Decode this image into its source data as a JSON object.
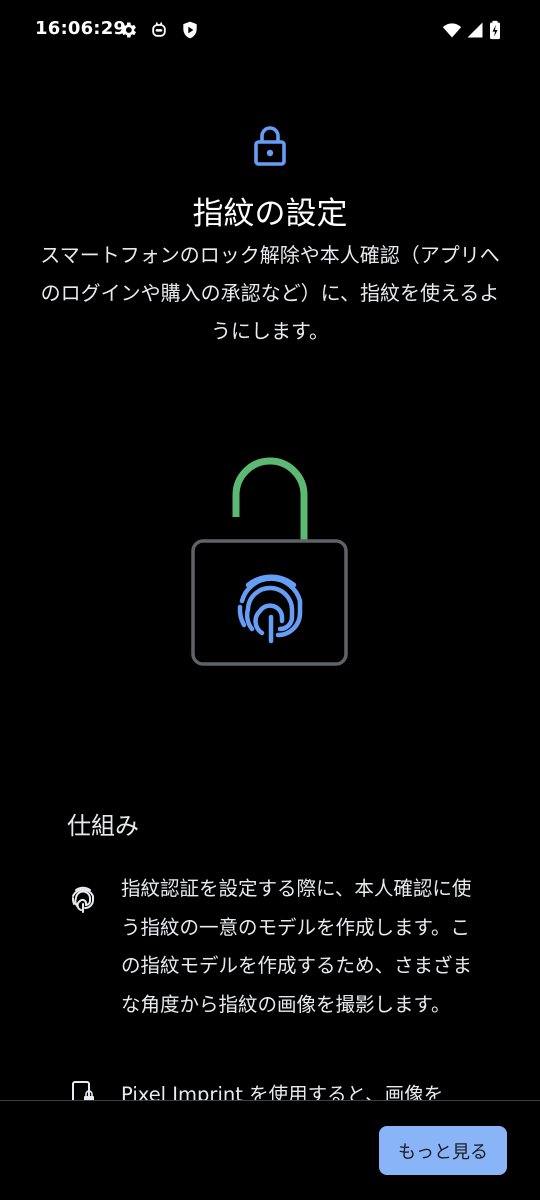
{
  "status_bar": {
    "time": "16:06:29",
    "left_icons": [
      "gear-icon",
      "robot-icon",
      "play-shield-icon"
    ],
    "right_icons": [
      "wifi-icon",
      "signal-icon",
      "battery-charging-icon"
    ]
  },
  "header": {
    "icon": "lock-icon",
    "title": "指紋の設定",
    "description": "スマートフォンのロック解除や本人確認（アプリへのログインや購入の承認など）に、指紋を使えるようにします。"
  },
  "illustration": {
    "icon": "fingerprint-unlock-illustration",
    "colors": {
      "shackle": "#5bb974",
      "body_outline": "#5f6368",
      "fingerprint": "#669df6"
    }
  },
  "how_it_works": {
    "heading": "仕組み",
    "items": [
      {
        "icon": "fingerprint-icon",
        "text": "指紋認証を設定する際に、本人確認に使う指紋の一意のモデルを作成します。この指紋モデルを作成するため、さまざまな角度から指紋の画像を撮影します。"
      },
      {
        "icon": "phone-lock-icon",
        "text": "Pixel Imprint を使用すると、画像を"
      }
    ]
  },
  "footer": {
    "more_button_label": "もっと見る"
  },
  "colors": {
    "accent": "#8ab4f8",
    "lock_icon": "#669df6",
    "background": "#000000"
  }
}
